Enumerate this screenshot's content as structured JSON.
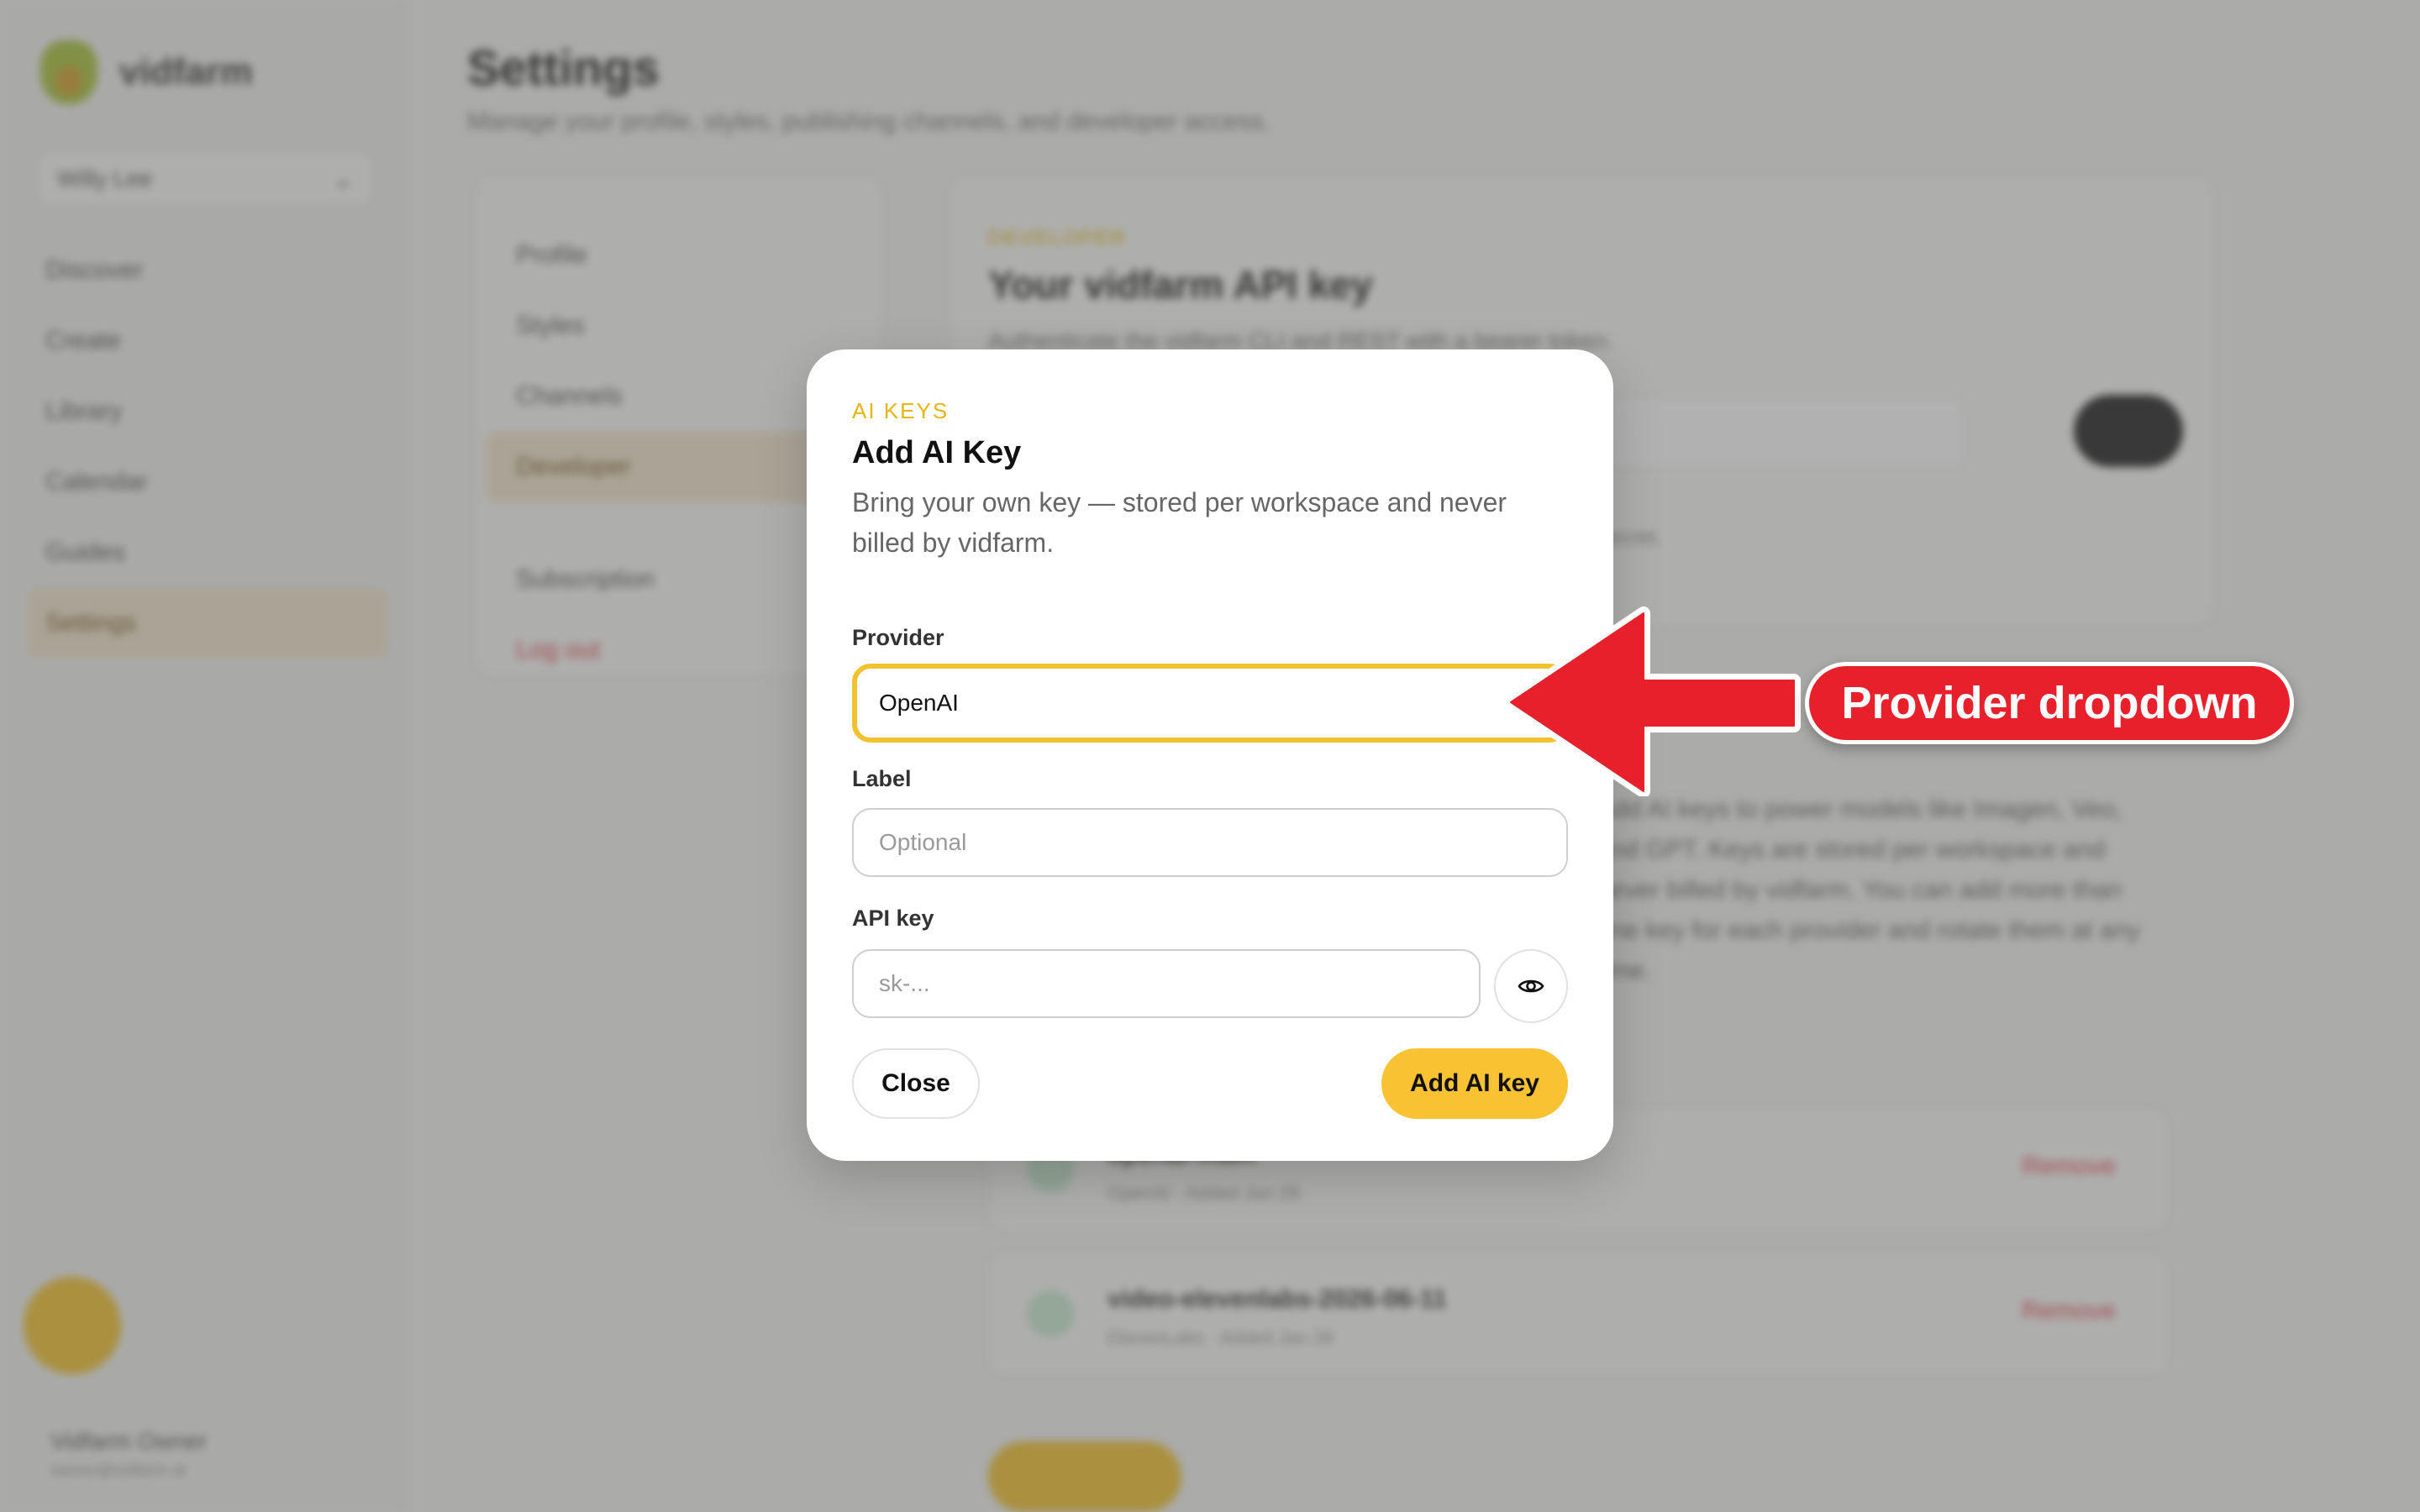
{
  "background": {
    "brand": "vidfarm",
    "workspace": "Willy Lee",
    "nav": [
      "Discover",
      "Create",
      "Library",
      "Calendar",
      "Guides",
      "Settings"
    ],
    "user_name": "Vidfarm Owner",
    "user_email": "owner@vidfarm.ai",
    "page_title": "Settings",
    "page_subtitle": "Manage your profile, styles, publishing channels, and developer access.",
    "settings_nav": [
      "Profile",
      "Styles",
      "Channels",
      "Developer",
      "Subscription",
      "Log out"
    ],
    "panel_eyebrow": "DEVELOPER",
    "panel_title": "Your vidfarm API key",
    "panel_subtitle": "Authenticate the vidfarm CLI and REST with a bearer token.",
    "panel_note": "Use this key to authenticate from your agent or scripts. Keep it secret.",
    "body_text": "Add AI keys to power models like Imagen, Veo, and GPT. Keys are stored per workspace and never billed by vidfarm. You can add more than one key for each provider and rotate them at any time.",
    "keys": [
      {
        "name": "openai-main",
        "meta": "OpenAI · Added Jan 28",
        "remove": "Remove"
      },
      {
        "name": "video-elevenlabs-2026-06-11",
        "meta": "ElevenLabs · Added Jan 28",
        "remove": "Remove"
      }
    ],
    "add_button": "Add AI key"
  },
  "modal": {
    "eyebrow": "AI KEYS",
    "title": "Add AI Key",
    "description": "Bring your own key — stored per workspace and never billed by vidfarm.",
    "provider_label": "Provider",
    "provider_value": "OpenAI",
    "label_label": "Label",
    "label_placeholder": "Optional",
    "apikey_label": "API key",
    "apikey_placeholder": "sk-...",
    "close_button": "Close",
    "submit_button": "Add AI key"
  },
  "annotation": {
    "callout_text": "Provider dropdown",
    "arrow_color": "#e8202b"
  },
  "colors": {
    "accent": "#f2c22e",
    "eyebrow": "#e8b410",
    "danger": "#e04848"
  }
}
